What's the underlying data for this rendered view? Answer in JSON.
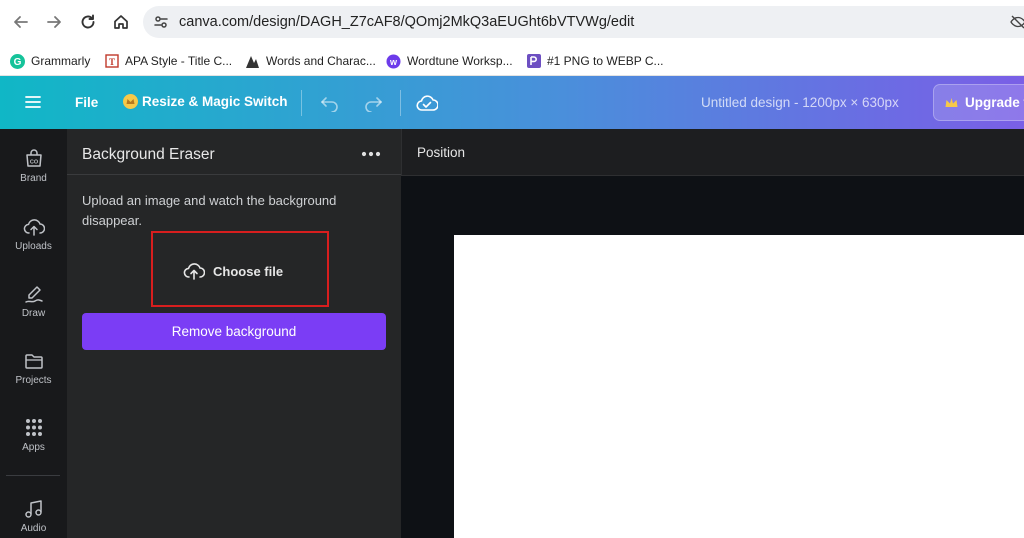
{
  "browser": {
    "url": "canva.com/design/DAGH_Z7cAF8/QOmj2MkQ3aEUGht6bVTVWg/edit"
  },
  "bookmarks": [
    {
      "label": "Grammarly",
      "icon": "grammarly-icon"
    },
    {
      "label": "APA Style - Title C...",
      "icon": "apa-icon"
    },
    {
      "label": "Words and Charac...",
      "icon": "words-icon"
    },
    {
      "label": "Wordtune Worksp...",
      "icon": "wordtune-icon"
    },
    {
      "label": "#1 PNG to WEBP C...",
      "icon": "png-webp-icon"
    }
  ],
  "toolbar": {
    "file_label": "File",
    "resize_label": "Resize & Magic Switch",
    "design_title": "Untitled design - 1200px × 630px",
    "upgrade_label": "Upgrade t"
  },
  "rail": {
    "items": [
      {
        "label": "Brand",
        "icon": "brand-icon"
      },
      {
        "label": "Uploads",
        "icon": "uploads-icon"
      },
      {
        "label": "Draw",
        "icon": "draw-icon"
      },
      {
        "label": "Projects",
        "icon": "projects-icon"
      },
      {
        "label": "Apps",
        "icon": "apps-icon"
      },
      {
        "label": "Audio",
        "icon": "audio-icon"
      }
    ]
  },
  "panel": {
    "title": "Background Eraser",
    "description": "Upload an image and watch the background disappear.",
    "choose_file_label": "Choose file",
    "remove_background_label": "Remove background"
  },
  "editor": {
    "position_label": "Position"
  },
  "colors": {
    "accent_purple": "#7b3df5",
    "highlight_red": "#d81e1e",
    "toolbar_start": "#10b7c6",
    "toolbar_end": "#7a5fe6"
  }
}
